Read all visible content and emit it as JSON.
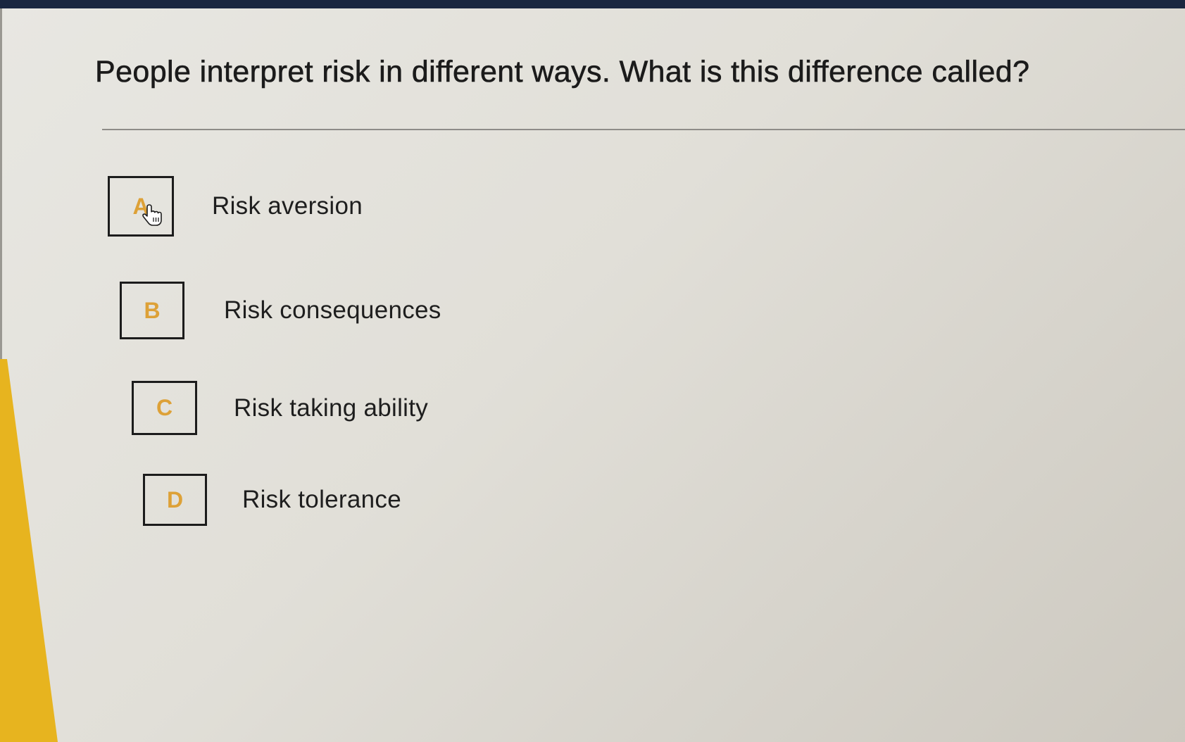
{
  "question": {
    "text": "People interpret risk in different ways. What is this difference called?"
  },
  "options": [
    {
      "letter": "A",
      "label": "Risk aversion"
    },
    {
      "letter": "B",
      "label": "Risk consequences"
    },
    {
      "letter": "C",
      "label": "Risk taking ability"
    },
    {
      "letter": "D",
      "label": "Risk tolerance"
    }
  ],
  "colors": {
    "letter_accent": "#dda137",
    "stripe": "#e7b41f",
    "top_bar": "#1a2740"
  },
  "cursor": {
    "icon": "hand-pointer-icon",
    "over_option": "A"
  }
}
